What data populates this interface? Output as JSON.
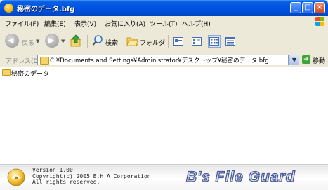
{
  "window": {
    "title": "秘密のデータ.bfg"
  },
  "menubar": {
    "items": [
      "ファイル(F)",
      "編集(E)",
      "表示(V)",
      "お気に入り(A)",
      "ツール(T)",
      "ヘルプ(H)"
    ]
  },
  "toolbar": {
    "back_label": "戻る",
    "search_label": "検索",
    "folder_label": "フォルダ"
  },
  "address": {
    "label": "アドレス(D)",
    "value": "C:¥Documents and Settings¥Administrator¥デスクトップ¥秘密のデータ.bfg",
    "go_label": "移動"
  },
  "content": {
    "items": [
      {
        "label": "秘密のデータ"
      }
    ]
  },
  "footer": {
    "version": "Version 1.00",
    "copyright": "Copyright(c) 2005 B.H.A Corporation",
    "rights": "All rights reserved.",
    "brand": "B's File Guard"
  },
  "colors": {
    "titlebar": "#0054e3",
    "close_button": "#d2471c",
    "go_button": "#3fa338",
    "brand_outline": "#4a5b9a"
  }
}
